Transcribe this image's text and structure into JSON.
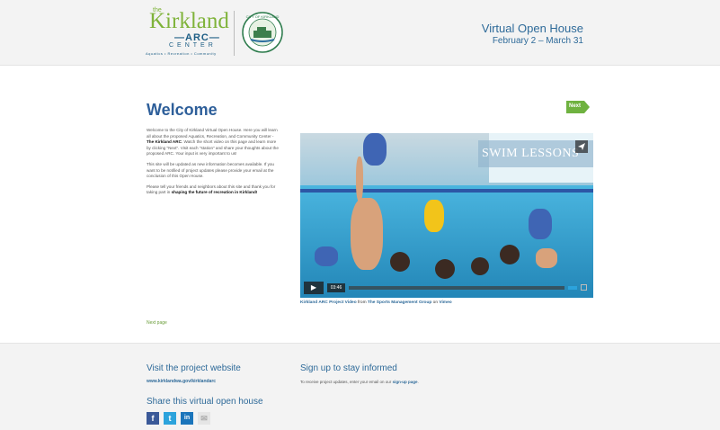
{
  "header": {
    "logo": {
      "the": "the",
      "name": "Kirkland",
      "arc": "ARC",
      "center": "CENTER",
      "tagline": "Aquatics • Recreation • Community",
      "seal_text": "CITY OF KIRKLAND WASHINGTON"
    },
    "title": "Virtual Open House",
    "dates": "February 2 – March 31"
  },
  "main": {
    "heading": "Welcome",
    "next_button": "Next",
    "paragraphs": [
      {
        "text_1": "Welcome to the City of Kirkland Virtual Open House. Here you will learn all about the proposed Aquatics, Recreation, and Community Center - ",
        "bold_1": "The Kirkland ARC",
        "text_2": ". Watch the short video on this page and learn more by clicking \"Next\". Visit each \"station\" and share your thoughts about the proposed ARC. Your input is very important to us!"
      },
      {
        "text_1": "This site will be updated as new information becomes available. If you want to be notified of project updates please provide your email at the conclusion of this Open House."
      },
      {
        "text_1": "Please tell your friends and neighbors about this site and thank you for taking part in ",
        "bold_1": "shaping the future of recreation in Kirkland!"
      }
    ],
    "video": {
      "banner": "SWIM LESSONS",
      "time": "03:46",
      "caption_title": "Kirkland ARC Project Video",
      "caption_from": " from ",
      "caption_author": "The Sports Management Group",
      "caption_on": " on ",
      "caption_site": "Vimeo"
    },
    "next_page": "Next page"
  },
  "footer": {
    "visit_heading": "Visit the project website",
    "visit_url": "www.kirklandwa.gov/kirklandarc",
    "share_heading": "Share this virtual open house",
    "signup_heading": "Sign up to stay informed",
    "signup_text": "To receive project updates, enter your email on our ",
    "signup_link": "sign-up page",
    "signup_end": ".",
    "social": [
      {
        "icon": "facebook-icon",
        "glyph": "f",
        "color": "#3b5998"
      },
      {
        "icon": "twitter-icon",
        "glyph": "t",
        "color": "#2ca3dc"
      },
      {
        "icon": "linkedin-icon",
        "glyph": "in",
        "color": "#1b75bb"
      },
      {
        "icon": "email-icon",
        "glyph": "✉",
        "color": "#cccccc"
      }
    ]
  },
  "colors": {
    "brand_green": "#7fb33a",
    "brand_blue": "#2e6a99",
    "next_green": "#6fb240"
  }
}
